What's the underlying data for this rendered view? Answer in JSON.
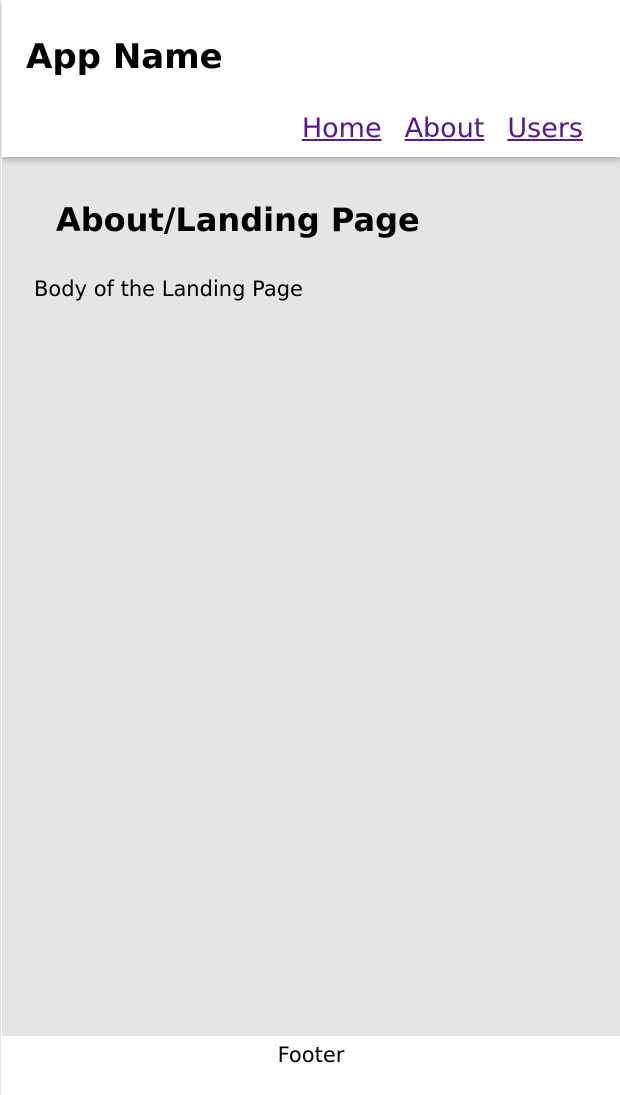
{
  "header": {
    "app_name": "App Name",
    "nav": [
      {
        "label": "Home"
      },
      {
        "label": "About"
      },
      {
        "label": "Users"
      }
    ]
  },
  "main": {
    "title": "About/Landing Page",
    "body": "Body of the Landing Page"
  },
  "footer": {
    "text": "Footer"
  },
  "colors": {
    "link": "#551a8b",
    "main_background": "#e5e5e5",
    "header_background": "#ffffff"
  }
}
